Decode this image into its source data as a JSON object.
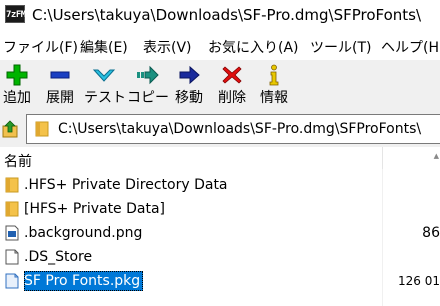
{
  "window": {
    "app_icon_text": "7zFM",
    "title": "C:\\Users\\takuya\\Downloads\\SF-Pro.dmg\\SFProFonts\\"
  },
  "menu": [
    {
      "label": "ファイル(F)"
    },
    {
      "label": "編集(E)"
    },
    {
      "label": "表示(V)"
    },
    {
      "label": "お気に入り(A)"
    },
    {
      "label": "ツール(T)"
    },
    {
      "label": "ヘルプ(H)"
    }
  ],
  "toolbar": [
    {
      "label": "追加",
      "icon": "add-icon",
      "color": "#00b000"
    },
    {
      "label": "展開",
      "icon": "extract-icon",
      "color": "#1a3fc2"
    },
    {
      "label": "テスト",
      "icon": "test-icon",
      "color": "#20b8d8"
    },
    {
      "label": "コピー",
      "icon": "copy-icon",
      "color": "#1a9080"
    },
    {
      "label": "移動",
      "icon": "move-icon",
      "color": "#1a2b9c"
    },
    {
      "label": "削除",
      "icon": "delete-icon",
      "color": "#e01010"
    },
    {
      "label": "情報",
      "icon": "info-icon",
      "color": "#e0c000"
    }
  ],
  "address": {
    "path": "C:\\Users\\takuya\\Downloads\\SF-Pro.dmg\\SFProFonts\\"
  },
  "list": {
    "header_name": "名前",
    "rows": [
      {
        "name": ".HFS+ Private Directory Data",
        "size": "",
        "type": "folder"
      },
      {
        "name": "[HFS+ Private Data]",
        "size": "",
        "type": "folder"
      },
      {
        "name": ".background.png",
        "size": "86",
        "type": "image"
      },
      {
        "name": ".DS_Store",
        "size": "",
        "type": "file"
      },
      {
        "name": "SF Pro Fonts.pkg",
        "size": "126 01",
        "type": "package",
        "selected": true
      }
    ]
  }
}
